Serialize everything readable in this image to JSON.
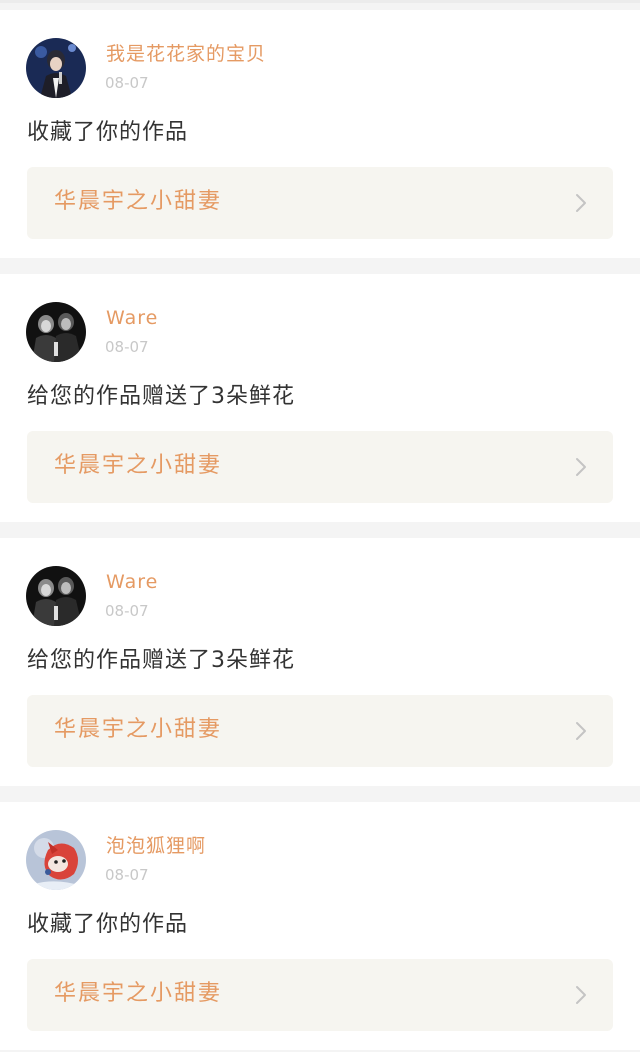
{
  "colors": {
    "accent": "#e59a63",
    "text": "#333333",
    "muted": "#c8c8c8",
    "link_bg": "#f6f5f0",
    "page_bg": "#f4f4f4"
  },
  "notifications": [
    {
      "username": "我是花花家的宝贝",
      "date": "08-07",
      "message": "收藏了你的作品",
      "work_title": "华晨宇之小甜妻",
      "avatar_icon": "performer-avatar",
      "chevron_icon": "chevron-right-icon"
    },
    {
      "username": "Ware",
      "date": "08-07",
      "message": "给您的作品赠送了3朵鲜花",
      "work_title": "华晨宇之小甜妻",
      "avatar_icon": "dark-photo-avatar",
      "chevron_icon": "chevron-right-icon"
    },
    {
      "username": "Ware",
      "date": "08-07",
      "message": "给您的作品赠送了3朵鲜花",
      "work_title": "华晨宇之小甜妻",
      "avatar_icon": "dark-photo-avatar",
      "chevron_icon": "chevron-right-icon"
    },
    {
      "username": "泡泡狐狸啊",
      "date": "08-07",
      "message": "收藏了你的作品",
      "work_title": "华晨宇之小甜妻",
      "avatar_icon": "fox-avatar",
      "chevron_icon": "chevron-right-icon"
    }
  ]
}
